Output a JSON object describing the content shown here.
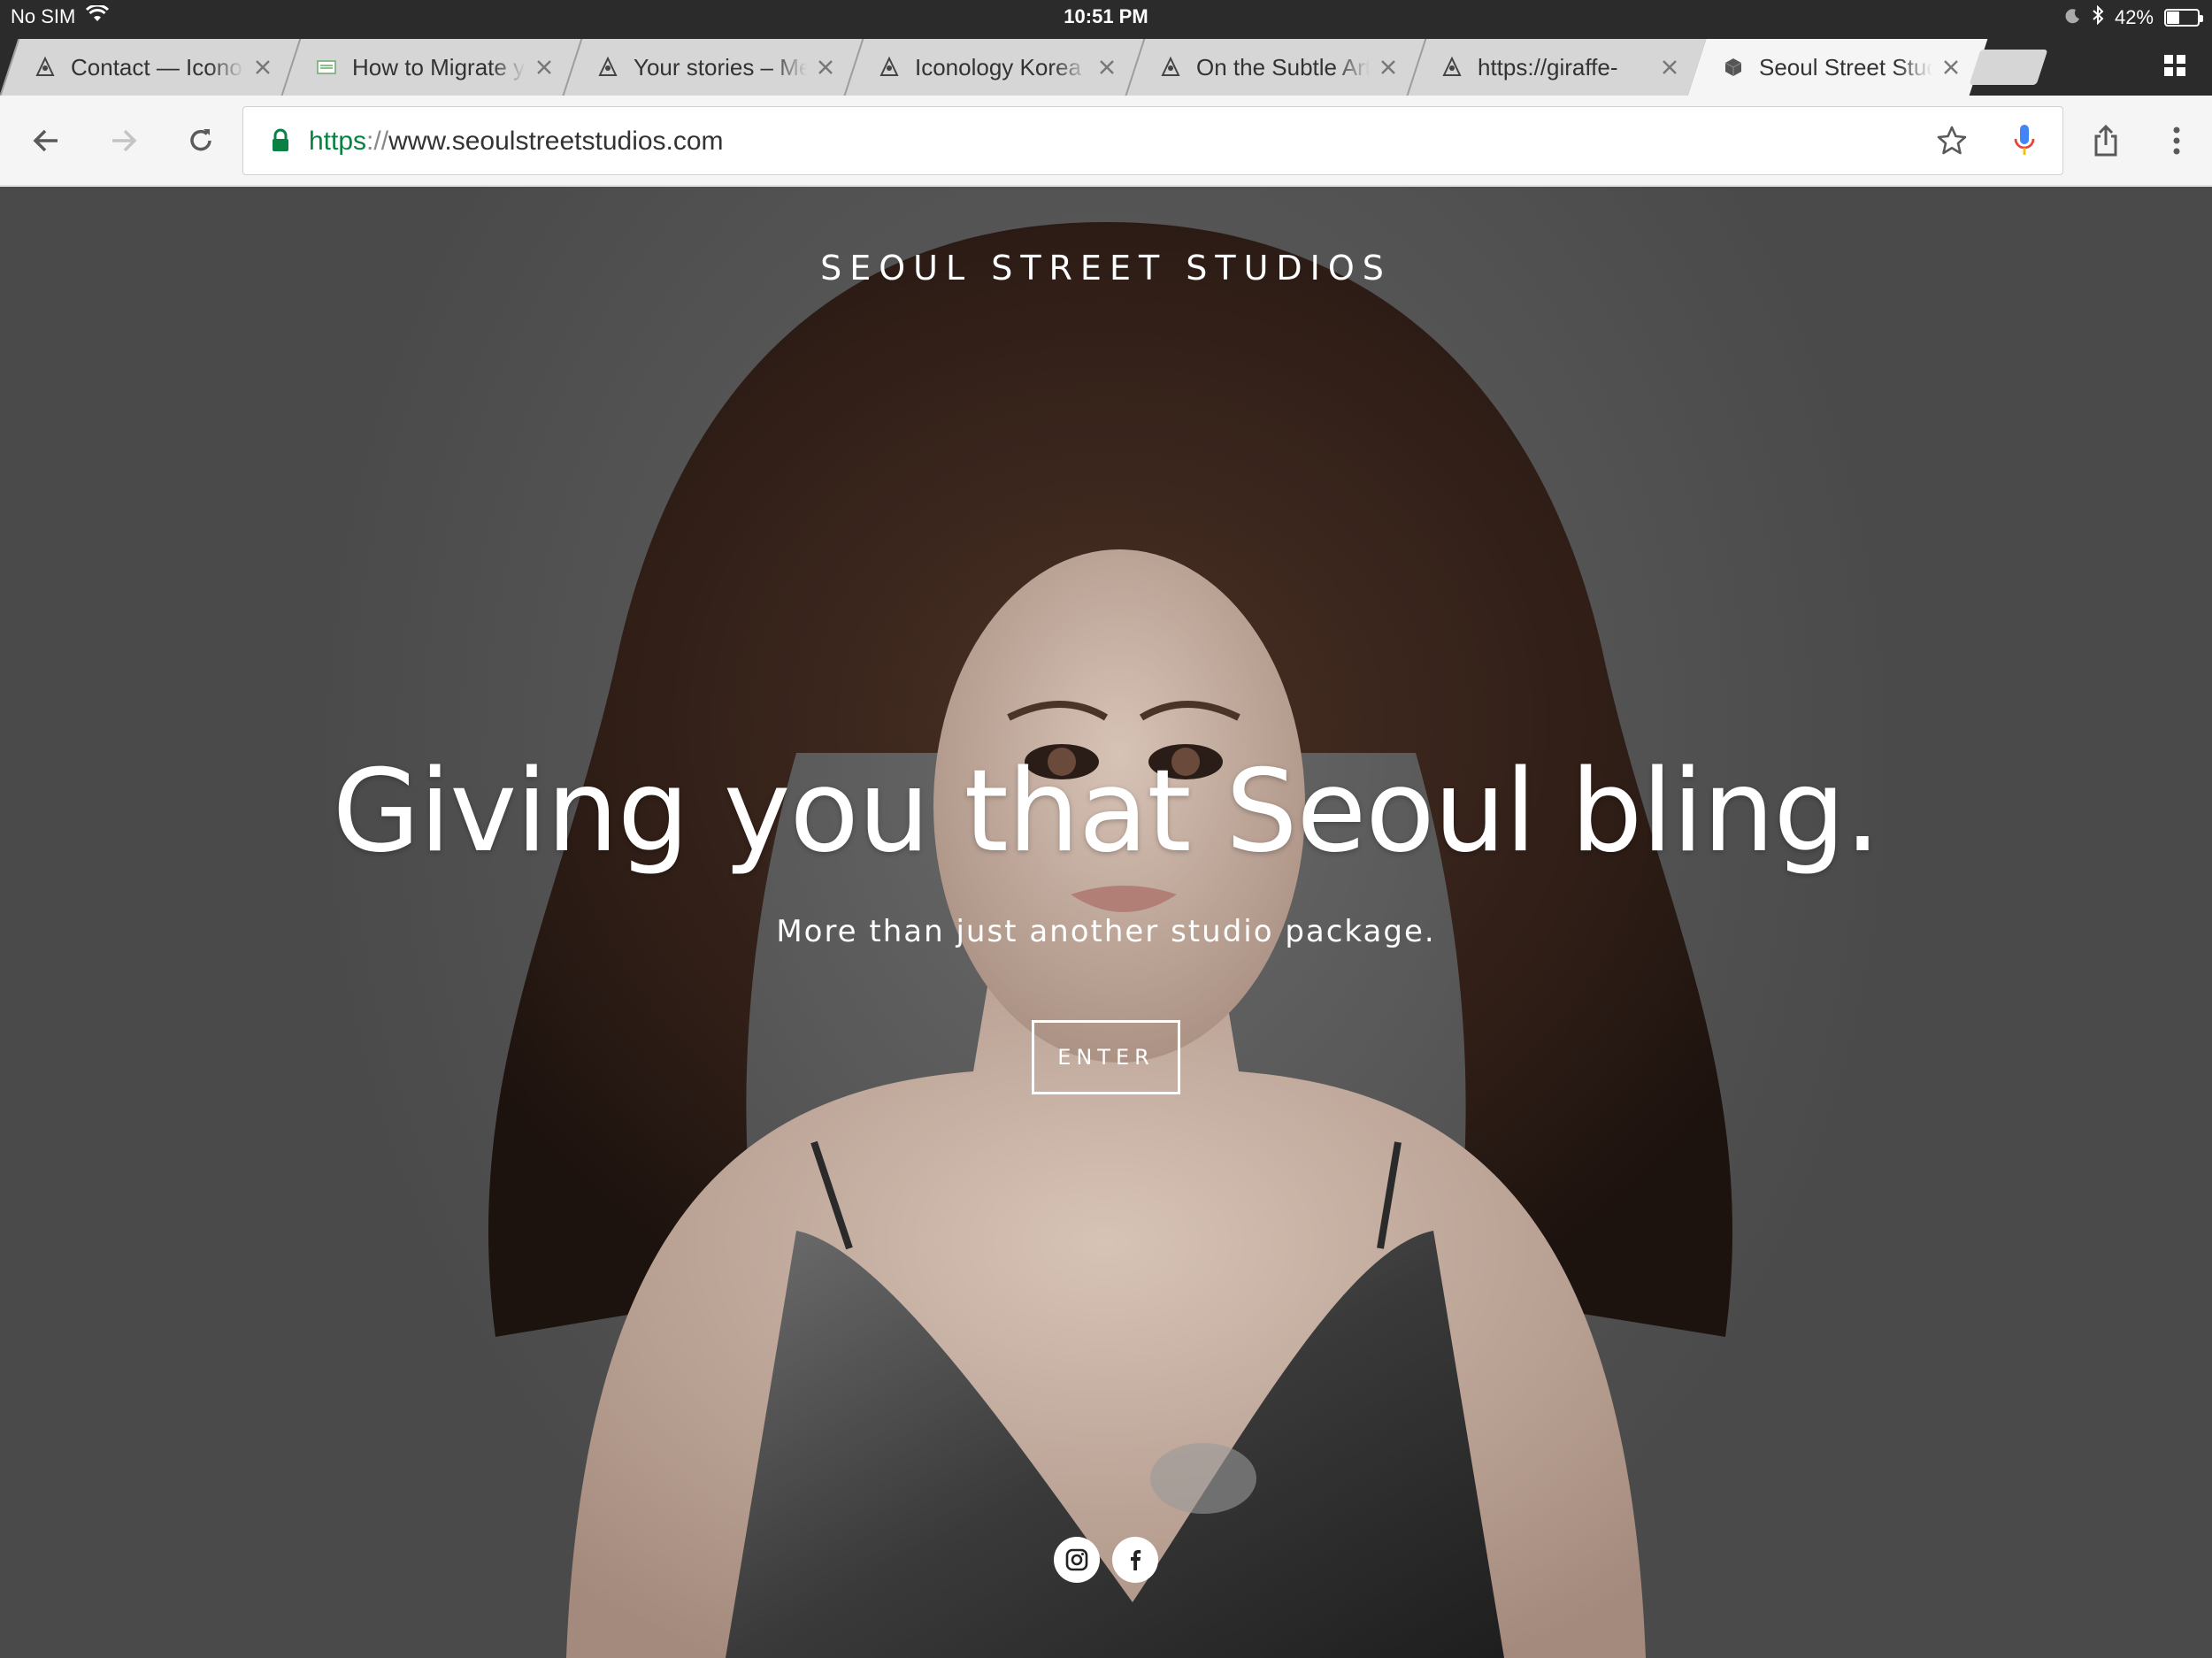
{
  "status_bar": {
    "carrier": "No SIM",
    "time": "10:51 PM",
    "battery": "42%",
    "battery_level": 0.42
  },
  "tabs": [
    {
      "title": "Contact — Iconolo",
      "favicon": "iconology-icon",
      "active": false
    },
    {
      "title": "How to Migrate yo",
      "favicon": "document-icon",
      "active": false
    },
    {
      "title": "Your stories – Me",
      "favicon": "iconology-icon",
      "active": false
    },
    {
      "title": "Iconology Korea",
      "favicon": "iconology-icon",
      "active": false
    },
    {
      "title": "On the Subtle Art",
      "favicon": "iconology-icon",
      "active": false
    },
    {
      "title": "https://giraffe-",
      "favicon": "iconology-icon",
      "active": false
    },
    {
      "title": "Seoul Street Studi",
      "favicon": "cube-icon",
      "active": true
    }
  ],
  "toolbar": {
    "url_scheme": "https",
    "url_separator": "://",
    "url_host": "www.seoulstreetstudios.com"
  },
  "hero": {
    "site_title": "SEOUL STREET STUDIOS",
    "headline": "Giving you that Seoul bling.",
    "subheadline": "More than just another studio package.",
    "enter_label": "ENTER"
  },
  "social": [
    "instagram-icon",
    "facebook-icon"
  ],
  "colors": {
    "secure_green": "#0b8043",
    "mic_blue": "#4285f4",
    "mic_red": "#ea4335",
    "mic_yellow": "#fbbc05",
    "mic_green": "#34a853"
  }
}
